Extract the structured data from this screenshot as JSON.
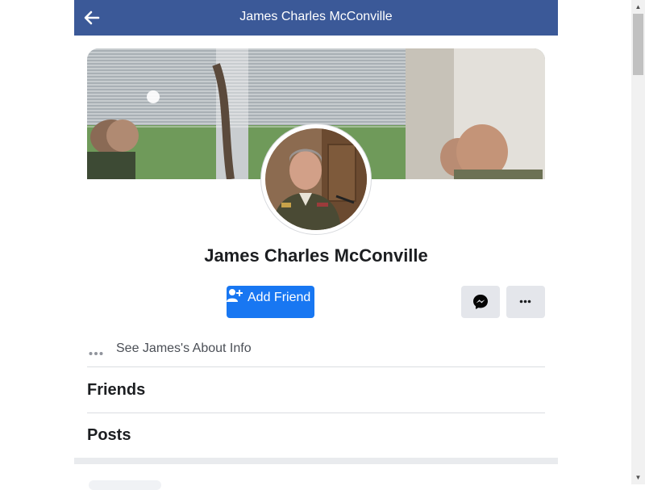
{
  "header": {
    "title": "James Charles McConville",
    "back_icon": "arrow-left-icon"
  },
  "profile": {
    "name": "James Charles McConville",
    "cover_icon": "cover-photo",
    "avatar_icon": "profile-photo"
  },
  "actions": {
    "add_friend_label": "Add Friend",
    "add_friend_icon": "person-plus-icon",
    "messenger_icon": "messenger-icon",
    "more_icon": "more-horizontal-icon"
  },
  "about": {
    "label": "See James's About Info",
    "icon": "more-dots-icon"
  },
  "sections": {
    "friends": "Friends",
    "posts": "Posts"
  },
  "colors": {
    "header_bg": "#3b5998",
    "primary_button": "#1877f2",
    "secondary_button": "#e4e6eb"
  }
}
